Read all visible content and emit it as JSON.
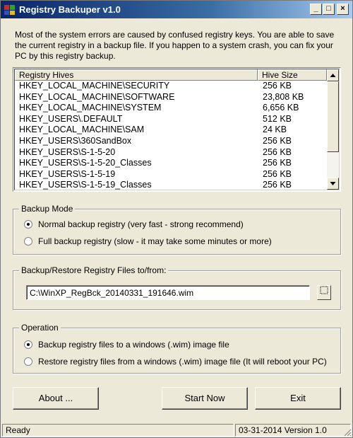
{
  "window": {
    "title": "Registry Backuper v1.0",
    "controls": {
      "minimize": "_",
      "maximize": "□",
      "close": "×"
    }
  },
  "description": "Most of the system errors are caused by confused registry keys. You are able to save the current registry in a backup file. If you happen to a system crash, you can fix your PC by this registry backup.",
  "hives": {
    "columns": [
      "Registry Hives",
      "Hive Size"
    ],
    "rows": [
      [
        "HKEY_LOCAL_MACHINE\\SECURITY",
        "256 KB"
      ],
      [
        "HKEY_LOCAL_MACHINE\\SOFTWARE",
        "23,808 KB"
      ],
      [
        "HKEY_LOCAL_MACHINE\\SYSTEM",
        "6,656 KB"
      ],
      [
        "HKEY_USERS\\.DEFAULT",
        "512 KB"
      ],
      [
        "HKEY_LOCAL_MACHINE\\SAM",
        "24 KB"
      ],
      [
        "HKEY_USERS\\360SandBox",
        "256 KB"
      ],
      [
        "HKEY_USERS\\S-1-5-20",
        "256 KB"
      ],
      [
        "HKEY_USERS\\S-1-5-20_Classes",
        "256 KB"
      ],
      [
        "HKEY_USERS\\S-1-5-19",
        "256 KB"
      ],
      [
        "HKEY_USERS\\S-1-5-19_Classes",
        "256 KB"
      ]
    ],
    "scrollbar": {
      "up_icon": "triangle-up",
      "down_icon": "triangle-down"
    }
  },
  "backup_mode": {
    "title": "Backup Mode",
    "options": [
      {
        "label": "Normal backup registry (very fast - strong recommend)",
        "selected": true
      },
      {
        "label": "Full backup registry (slow - it may take some minutes or more)",
        "selected": false
      }
    ]
  },
  "files": {
    "title": "Backup/Restore Registry Files to/from:",
    "path": "C:\\WinXP_RegBck_20140331_191646.wim",
    "browse_icon": "ellipsis-browse-icon"
  },
  "operation": {
    "title": "Operation",
    "options": [
      {
        "label": "Backup registry files to a windows (.wim) image file",
        "selected": true
      },
      {
        "label": "Restore registry files from a windows (.wim) image file (It will reboot your PC)",
        "selected": false
      }
    ]
  },
  "buttons": {
    "about": "About ...",
    "start": "Start Now",
    "exit": "Exit"
  },
  "status": {
    "left": "Ready",
    "right": "03-31-2014 Version 1.0"
  },
  "colors": {
    "titlebar_start": "#0a246a",
    "titlebar_end": "#a6caf0",
    "window_bg": "#ece9d8"
  }
}
